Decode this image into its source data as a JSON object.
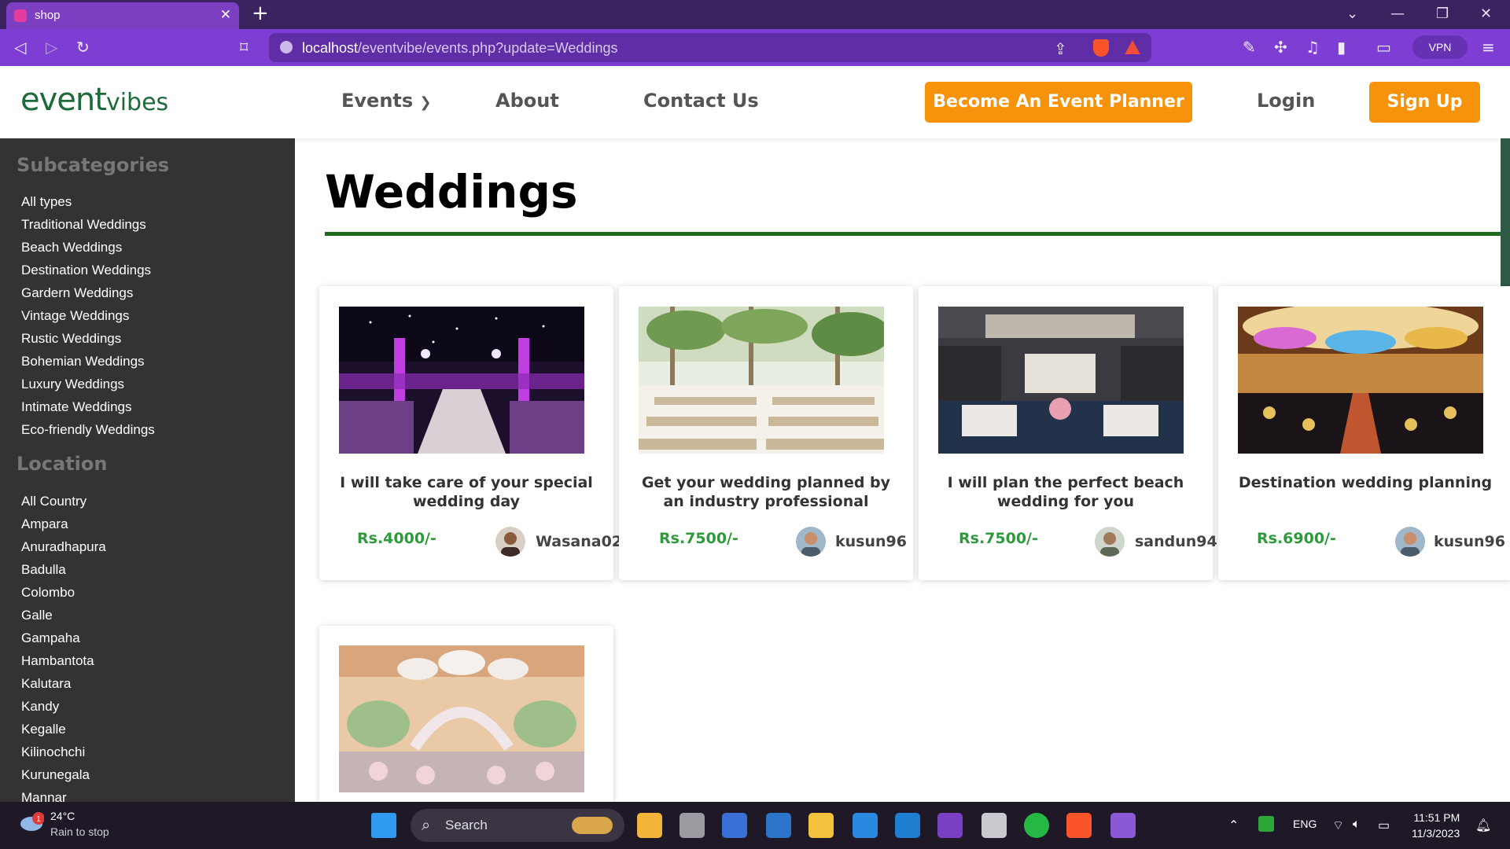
{
  "browser": {
    "tab_title": "shop",
    "url_host": "localhost",
    "url_path": "/eventvibe/events.php?update=Weddings",
    "vpn_label": "VPN"
  },
  "header": {
    "logo_event": "event",
    "logo_vibes": "vibes",
    "nav_events": "Events",
    "nav_about": "About",
    "nav_contact": "Contact Us",
    "become_planner": "Become An Event Planner",
    "login": "Login",
    "signup": "Sign Up"
  },
  "sidebar": {
    "subcategories_heading": "Subcategories",
    "subcategories": [
      "All types",
      "Traditional Weddings",
      "Beach Weddings",
      "Destination Weddings",
      "Gardern Weddings",
      "Vintage Weddings",
      "Rustic Weddings",
      "Bohemian Weddings",
      "Luxury Weddings",
      "Intimate Weddings",
      "Eco-friendly Weddings"
    ],
    "location_heading": "Location",
    "locations": [
      "All Country",
      "Ampara",
      "Anuradhapura",
      "Badulla",
      "Colombo",
      "Galle",
      "Gampaha",
      "Hambantota",
      "Kalutara",
      "Kandy",
      "Kegalle",
      "Kilinochchi",
      "Kurunegala",
      "Mannar"
    ]
  },
  "main": {
    "title": "Weddings",
    "cards": [
      {
        "title": "I will take care of your special wedding day",
        "price": "Rs.4000/-",
        "user": "Wasana02",
        "image": "purple-lit-hall"
      },
      {
        "title": "Get your wedding planned by an industry professional",
        "price": "Rs.7500/-",
        "user": "kusun96",
        "image": "garden-tables"
      },
      {
        "title": "I will plan the perfect beach wedding for you",
        "price": "Rs.7500/-",
        "user": "sandun94",
        "image": "chandelier-ballroom"
      },
      {
        "title": "Destination wedding planning",
        "price": "Rs.6900/-",
        "user": "kusun96",
        "image": "golden-banquet-hall"
      },
      {
        "title": "",
        "price": "",
        "user": "",
        "image": "floral-tent-stage"
      }
    ]
  },
  "taskbar": {
    "temperature": "24°C",
    "weather": "Rain to stop",
    "search_label": "Search",
    "language": "ENG",
    "time": "11:51 PM",
    "date": "11/3/2023",
    "notification_count": "1"
  },
  "colors": {
    "accent_orange": "#f7930a",
    "brand_green": "#1d6b3a",
    "price_green": "#2e9a3c",
    "sidebar_bg": "#333333",
    "browser_purple": "#7e3ed3"
  }
}
